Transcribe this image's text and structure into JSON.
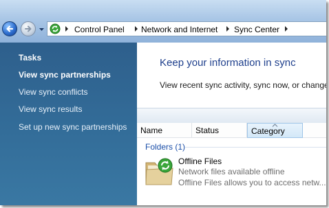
{
  "navigation": {
    "back_icon": "back-arrow-icon",
    "forward_icon": "forward-arrow-icon",
    "address_icon": "sync-center-icon",
    "breadcrumbs": [
      "Control Panel",
      "Network and Internet",
      "Sync Center"
    ]
  },
  "tasks": {
    "heading": "Tasks",
    "items": [
      "View sync partnerships",
      "View sync conflicts",
      "View sync results",
      "Set up new sync partnerships"
    ],
    "selected_item": "View sync partnerships"
  },
  "main": {
    "title": "Keep your information in sync",
    "subtitle": "View recent sync activity, sync now, or change",
    "columns": [
      "Name",
      "Status",
      "Category"
    ],
    "sorted_column": "Category",
    "group": {
      "label": "Folders (1)",
      "items": [
        {
          "name": "Offline Files",
          "description_1": "Network files available offline",
          "description_2": "Offline Files allows you to access netw...",
          "icon": "sync-folder-icon"
        }
      ]
    }
  },
  "colors": {
    "task_pane": "#336d99",
    "title": "#1e3f8c",
    "group_label": "#1a4ea8",
    "accent_green": "#3aa63a"
  }
}
